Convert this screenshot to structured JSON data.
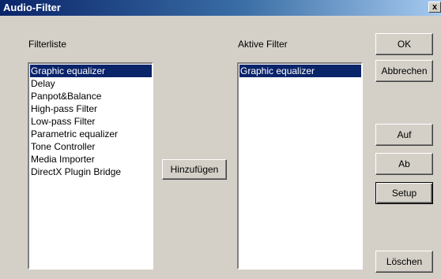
{
  "window": {
    "title": "Audio-Filter",
    "close_glyph": "x"
  },
  "filter_list": {
    "label": "Filterliste",
    "items": [
      "Graphic equalizer",
      "Delay",
      "Panpot&Balance",
      "High-pass Filter",
      "Low-pass Filter",
      "Parametric equalizer",
      "Tone Controller",
      "Media Importer",
      "DirectX Plugin Bridge"
    ],
    "selected_index": 0
  },
  "active_filters": {
    "label": "Aktive Filter",
    "items": [
      "Graphic equalizer"
    ],
    "selected_index": 0
  },
  "buttons": {
    "add": "Hinzufügen",
    "ok": "OK",
    "cancel": "Abbrechen",
    "up": "Auf",
    "down": "Ab",
    "setup": "Setup",
    "delete": "Löschen"
  }
}
